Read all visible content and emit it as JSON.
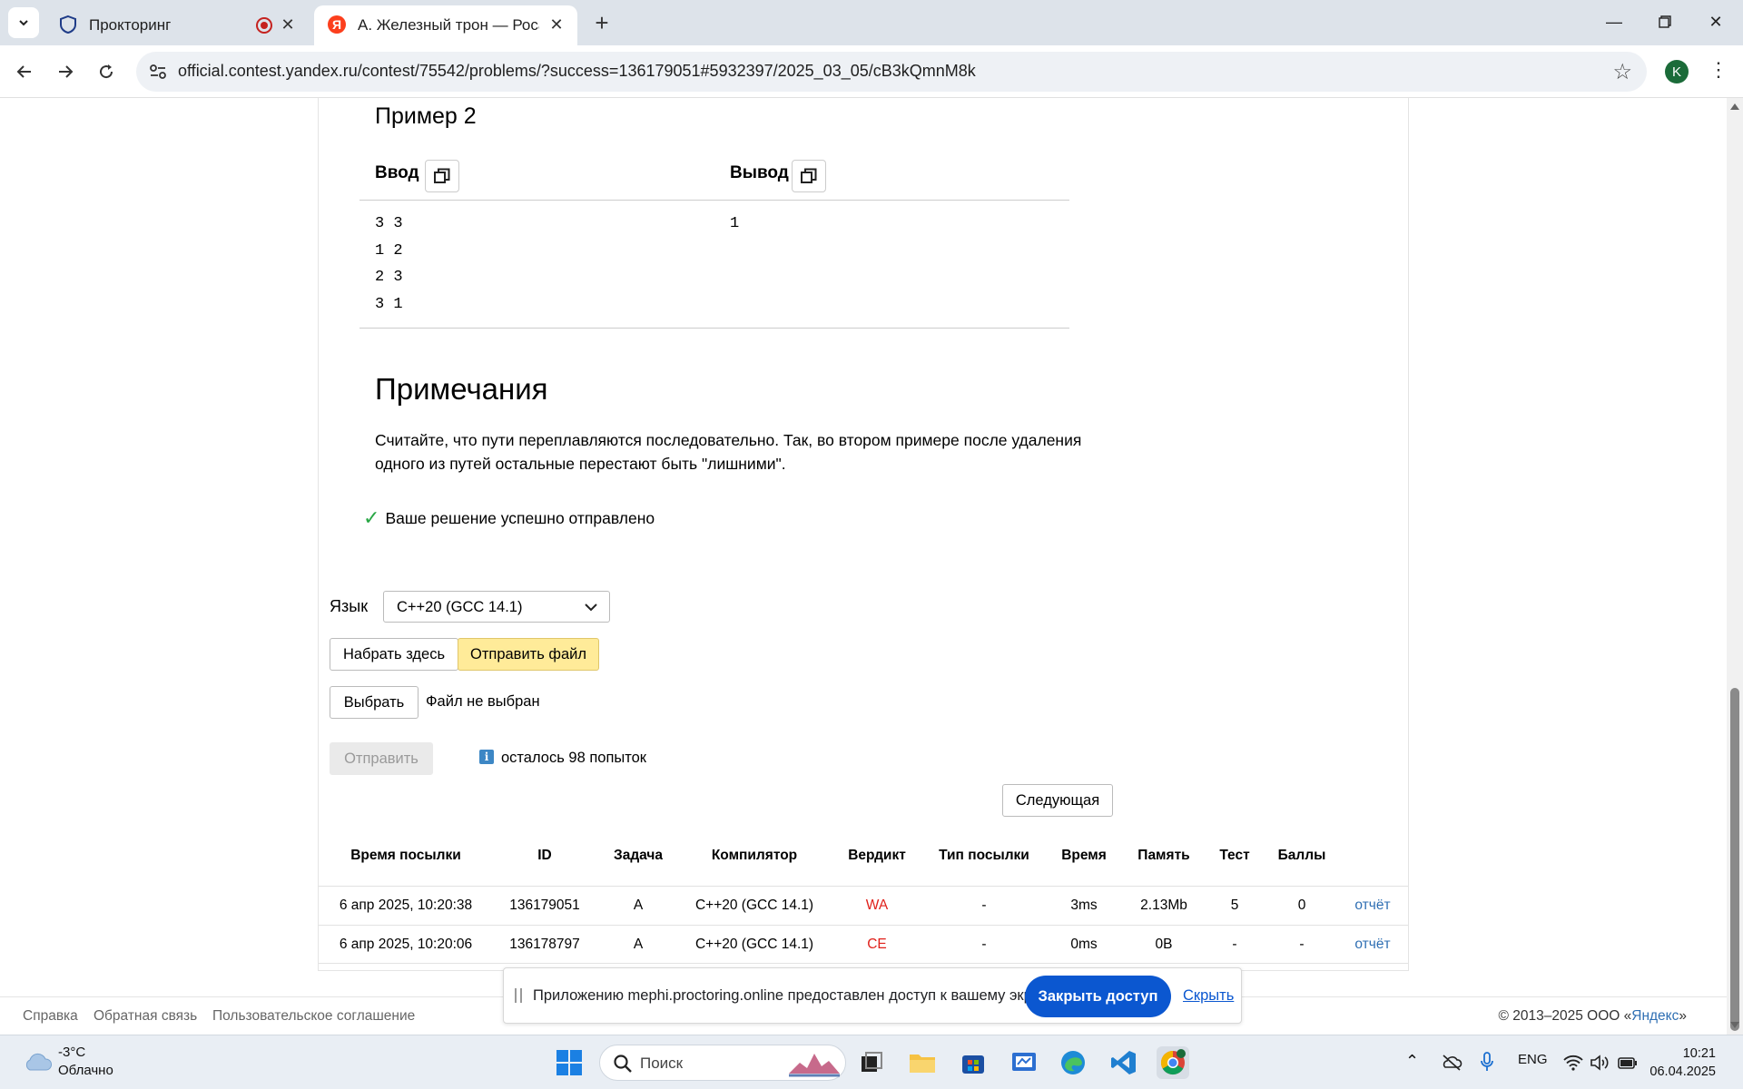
{
  "browser": {
    "tabs": [
      {
        "title": "Прокторинг",
        "active": false,
        "recording": true
      },
      {
        "title": "A. Железный трон — Росатом",
        "active": true
      }
    ],
    "url": "official.contest.yandex.ru/contest/75542/problems/?success=136179051#5932397/2025_03_05/cB3kQmnM8k",
    "profile_initial": "K"
  },
  "sample": {
    "heading": "Пример 2",
    "input_label": "Ввод",
    "output_label": "Вывод",
    "input_text": "3 3\n1 2\n2 3\n3 1",
    "output_text": "1"
  },
  "notes": {
    "heading": "Примечания",
    "text": "Считайте, что пути переплавляются последовательно. Так, во втором примере после удаления одного из путей остальные перестают быть \"лишними\"."
  },
  "success_message": "Ваше решение успешно отправлено",
  "submit": {
    "language_label": "Язык",
    "language_value": "C++20 (GCC 14.1)",
    "tab_type": "Набрать здесь",
    "tab_file": "Отправить файл",
    "choose_button": "Выбрать",
    "file_status": "Файл не выбран",
    "submit_button": "Отправить",
    "attempts_left": "осталось 98 попыток",
    "next_button": "Следующая"
  },
  "table": {
    "headers": [
      "Время посылки",
      "ID",
      "Задача",
      "Компилятор",
      "Вердикт",
      "Тип посылки",
      "Время",
      "Память",
      "Тест",
      "Баллы"
    ],
    "rows": [
      {
        "time": "6 апр 2025, 10:20:38",
        "id": "136179051",
        "task": "A",
        "compiler": "C++20 (GCC 14.1)",
        "verdict": "WA",
        "type": "-",
        "exec_time": "3ms",
        "memory": "2.13Mb",
        "test": "5",
        "score": "0",
        "report": "отчёт"
      },
      {
        "time": "6 апр 2025, 10:20:06",
        "id": "136178797",
        "task": "A",
        "compiler": "C++20 (GCC 14.1)",
        "verdict": "CE",
        "type": "-",
        "exec_time": "0ms",
        "memory": "0B",
        "test": "-",
        "score": "-",
        "report": "отчёт"
      }
    ]
  },
  "footer": {
    "links": [
      "Справка",
      "Обратная связь",
      "Пользовательское соглашение"
    ],
    "copyright_prefix": "© 2013–2025 ООО «",
    "copyright_brand": "Яндекс",
    "copyright_suffix": "»"
  },
  "share_bar": {
    "message": "Приложению mephi.proctoring.online предоставлен доступ к вашему экрану.",
    "stop_button": "Закрыть доступ",
    "hide_link": "Скрыть"
  },
  "taskbar": {
    "weather_temp": "-3°C",
    "weather_cond": "Облачно",
    "search_placeholder": "Поиск",
    "language": "ENG",
    "time": "10:21",
    "date": "06.04.2025"
  },
  "colors": {
    "verdict_error": "#e0211b",
    "link": "#2f6fb3",
    "accent_yellow": "#ffeb99",
    "share_button": "#0b57d0"
  }
}
